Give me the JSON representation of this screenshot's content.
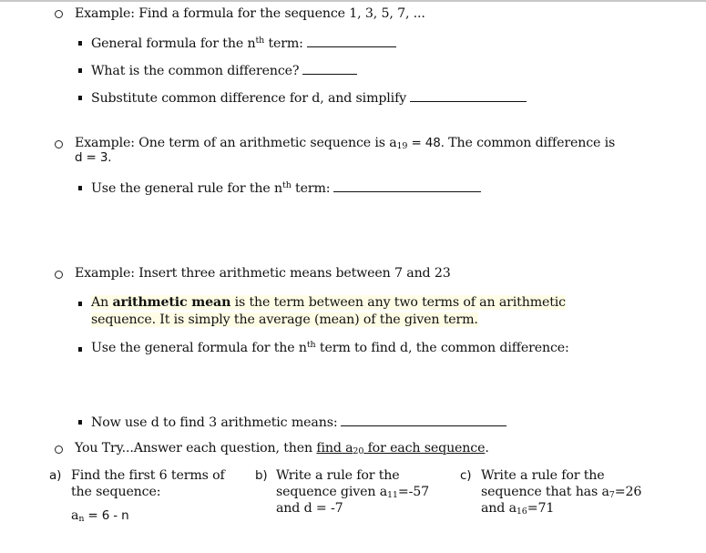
{
  "example1": {
    "heading": "Example:  Find a formula for the sequence 1, 3, 5, 7, ...",
    "items": [
      {
        "pre": "General formula for the n",
        "sup": "th",
        "post": " term:"
      },
      {
        "pre": "What is the common difference?"
      },
      {
        "pre": "Substitute common difference for d, and simplify"
      }
    ]
  },
  "example2": {
    "heading_pre": "Example:  One term of an arithmetic sequence is a",
    "heading_sub": "19",
    "heading_eq": " = 48.",
    "heading_post": "  The common difference is",
    "line2": "d = 3.",
    "item": {
      "pre": "Use the general rule for the n",
      "sup": "th",
      "post": " term:"
    }
  },
  "example3": {
    "heading": "Example:  Insert three arithmetic means between 7 and 23",
    "definition": {
      "pre": "An ",
      "bold": "arithmetic mean",
      "post": " is the term between any two terms of an arithmetic",
      "line2": "sequence.  It is simply the average (mean) of the given term."
    },
    "item2": {
      "pre": "Use the general formula for the n",
      "sup": "th",
      "post": " term to find d, the common difference:"
    },
    "item3": "Now use d to find 3 arithmetic means:"
  },
  "you_try": {
    "pre": "You Try...Answer each question, then ",
    "underlined_pre": "find a",
    "underlined_sub": "20",
    "underlined_post": " for each sequence",
    "end": ".",
    "problems": [
      {
        "label": "a)",
        "line1": "Find the first 6 terms of",
        "line2": "the sequence:",
        "formula_pre": "a",
        "formula_sub": "n",
        "formula_post": " = 6 - n"
      },
      {
        "label": "b)",
        "line1": "Write a rule for the",
        "line2_pre": "sequence given a",
        "line2_sub": "11",
        "line2_post": "=-57",
        "line3": "and d = -7"
      },
      {
        "label": "c)",
        "line1": "Write a rule for the",
        "line2_pre": "sequence that has a",
        "line2_sub": "7",
        "line2_post": "=26",
        "line3_pre": "and a",
        "line3_sub": "16",
        "line3_post": "=71"
      }
    ]
  }
}
